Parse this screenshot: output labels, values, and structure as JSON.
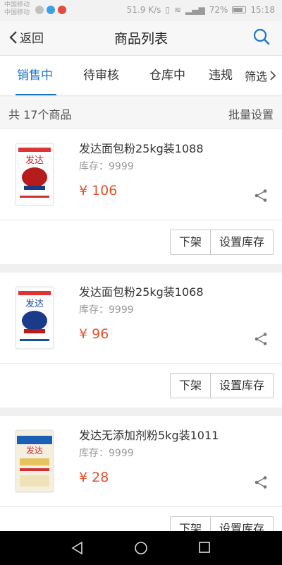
{
  "status_bar": {
    "carrier_1": "中国移动",
    "carrier_2": "中国移动",
    "speed": "51.9 K/s",
    "battery_text": "72%",
    "time": "15:18"
  },
  "nav": {
    "back_label": "返回",
    "title": "商品列表"
  },
  "tabs": [
    {
      "label": "销售中",
      "active": true
    },
    {
      "label": "待审核",
      "active": false
    },
    {
      "label": "仓库中",
      "active": false
    },
    {
      "label": "违规",
      "active": false
    }
  ],
  "filter_label": "筛选",
  "summary": {
    "count_text": "共 17个商品",
    "batch_label": "批量设置"
  },
  "products": [
    {
      "name": "发达面包粉25kg装1088",
      "stock": "库存：9999",
      "price": "¥ 106",
      "offshelf_label": "下架",
      "stock_btn_label": "设置库存"
    },
    {
      "name": "发达面包粉25kg装1068",
      "stock": "库存：9999",
      "price": "¥ 96",
      "offshelf_label": "下架",
      "stock_btn_label": "设置库存"
    },
    {
      "name": "发达无添加剂粉5kg装1011",
      "stock": "库存：9999",
      "price": "¥ 28",
      "offshelf_label": "下架",
      "stock_btn_label": "设置库存"
    }
  ],
  "product_brand": "发达",
  "colors": {
    "accent": "#1a75c8",
    "price": "#e3532e",
    "sys_nav": "#000000"
  },
  "icons": [
    "back-chevron-icon",
    "search-icon",
    "chevron-right-icon",
    "share-icon",
    "nav-back-triangle-icon",
    "nav-home-circle-icon",
    "nav-recent-square-icon"
  ]
}
